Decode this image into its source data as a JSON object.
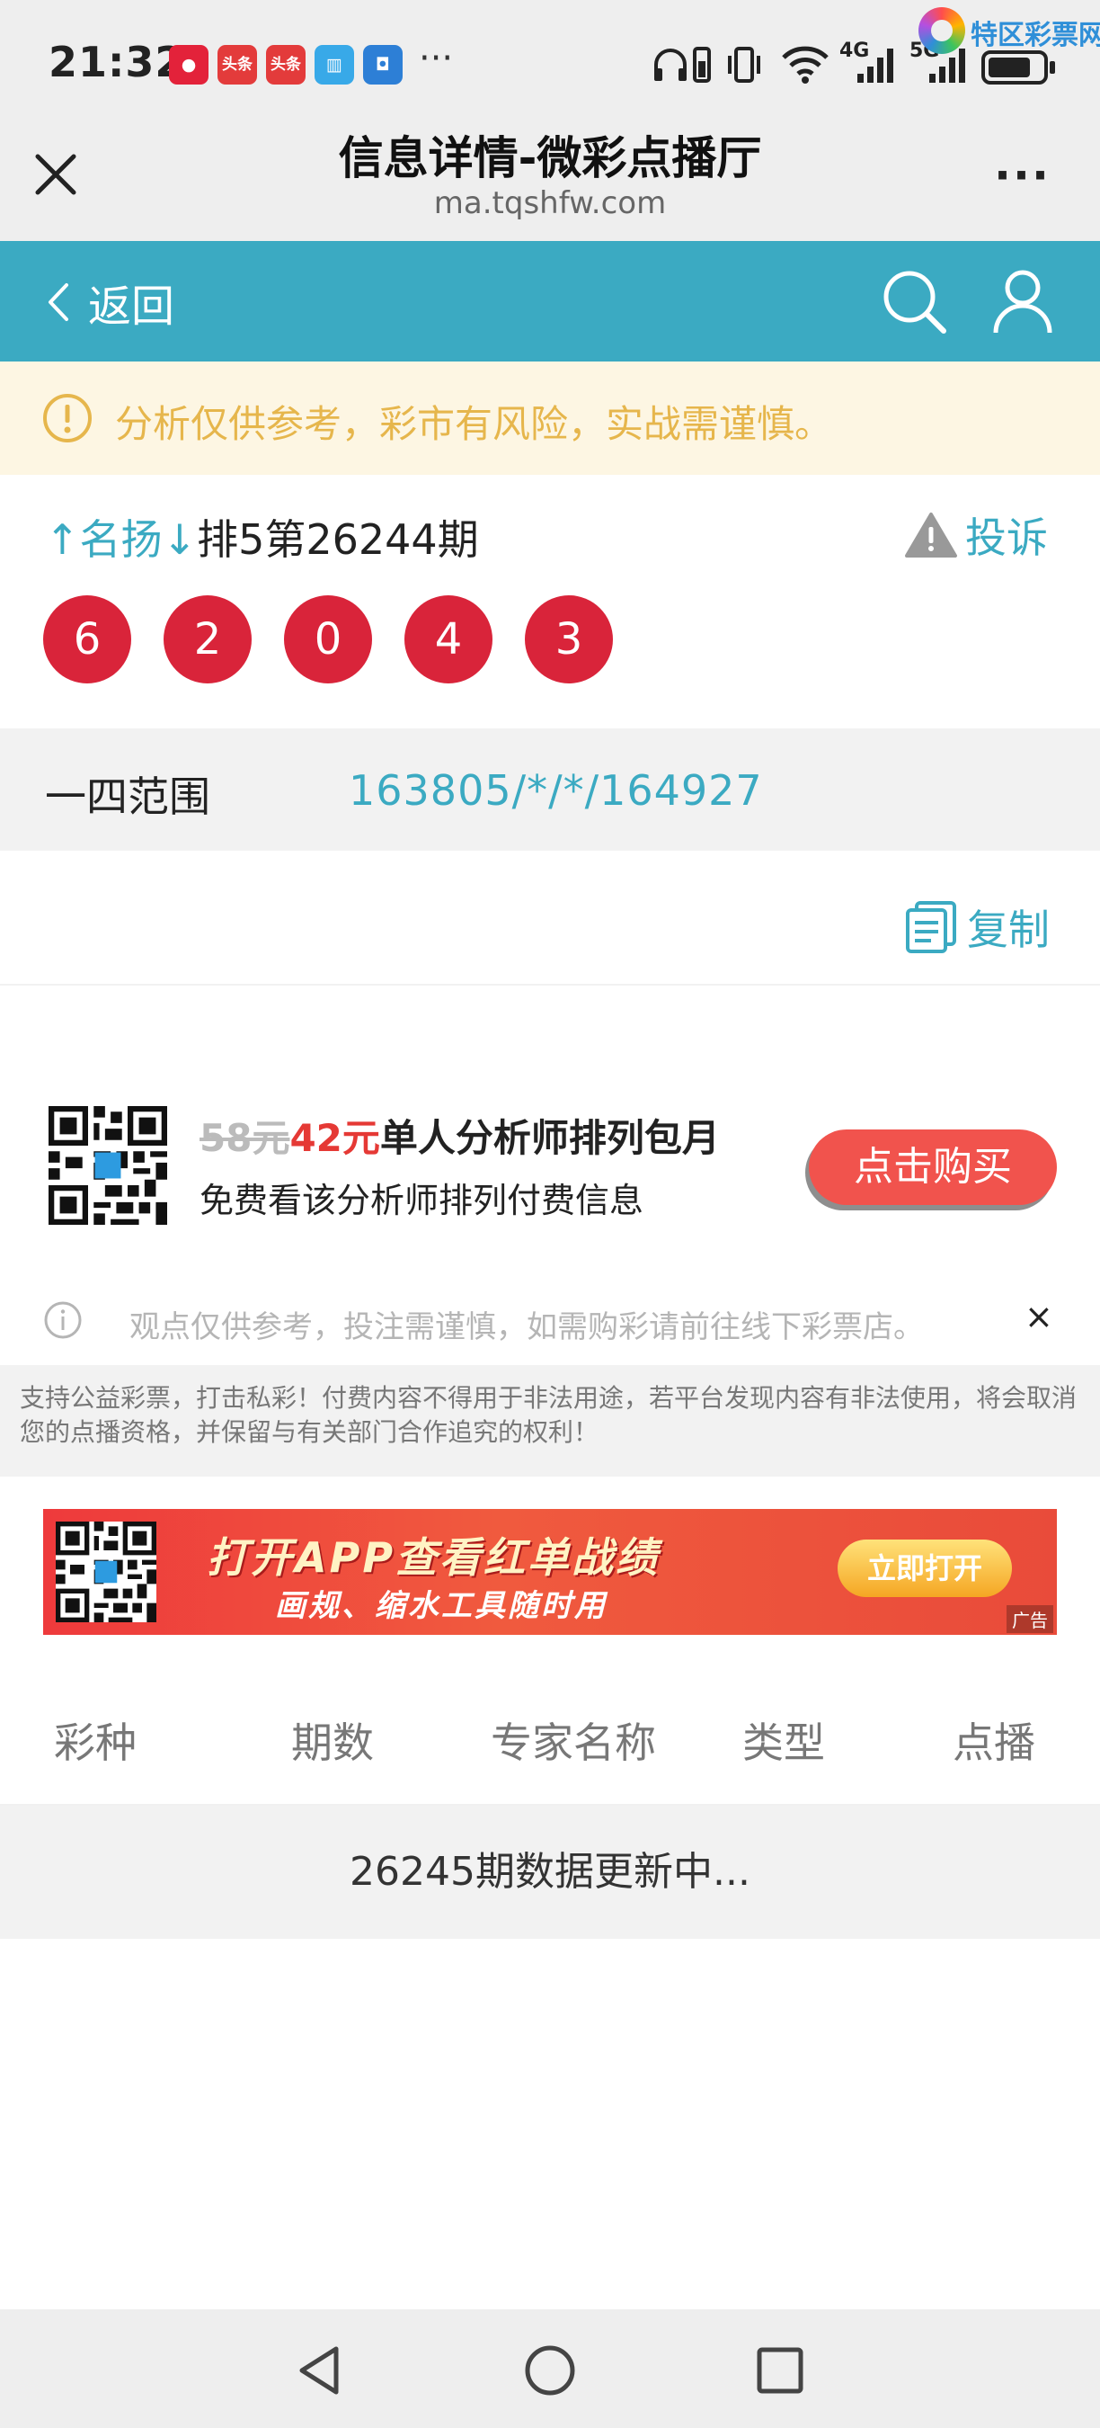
{
  "status_bar": {
    "time": "21:32",
    "app_icons": [
      "头条",
      "头条"
    ],
    "more": "···",
    "network_4g": "4G",
    "network_5g": "5G",
    "battery_level": 0.8,
    "watermark": "特区彩票网"
  },
  "titlebar": {
    "title": "信息详情-微彩点播厅",
    "url": "ma.tqshfw.com",
    "more": "···"
  },
  "navbar": {
    "back_label": "返回"
  },
  "warning": {
    "text": "分析仅供参考，彩市有风险，实战需谨慎。"
  },
  "issue": {
    "expert_name": "↑名扬↓",
    "issue_text": "排5第26244期",
    "complain_label": "投诉",
    "numbers": [
      "6",
      "2",
      "0",
      "4",
      "3"
    ]
  },
  "range": {
    "label": "一四范围",
    "value": "163805/*/*/164927"
  },
  "copy": {
    "label": "复制"
  },
  "promo": {
    "old_price": "58元",
    "new_price": "42元",
    "title": "单人分析师排列包月",
    "subtitle": "免费看该分析师排列付费信息",
    "buy_label": "点击购买"
  },
  "notice": {
    "text": "观点仅供参考，投注需谨慎，如需购彩请前往线下彩票店。",
    "close": "×"
  },
  "disclaimer": "支持公益彩票，打击私彩！付费内容不得用于非法用途，若平台发现内容有非法使用，将会取消您的点播资格，并保留与有关部门合作追究的权利！",
  "ad": {
    "line1": "打开APP查看红单战绩",
    "line2": "画规、缩水工具随时用",
    "button": "立即打开",
    "tag": "广告"
  },
  "table": {
    "headers": [
      "彩种",
      "期数",
      "专家名称",
      "类型",
      "点播"
    ],
    "status": "26245期数据更新中..."
  }
}
